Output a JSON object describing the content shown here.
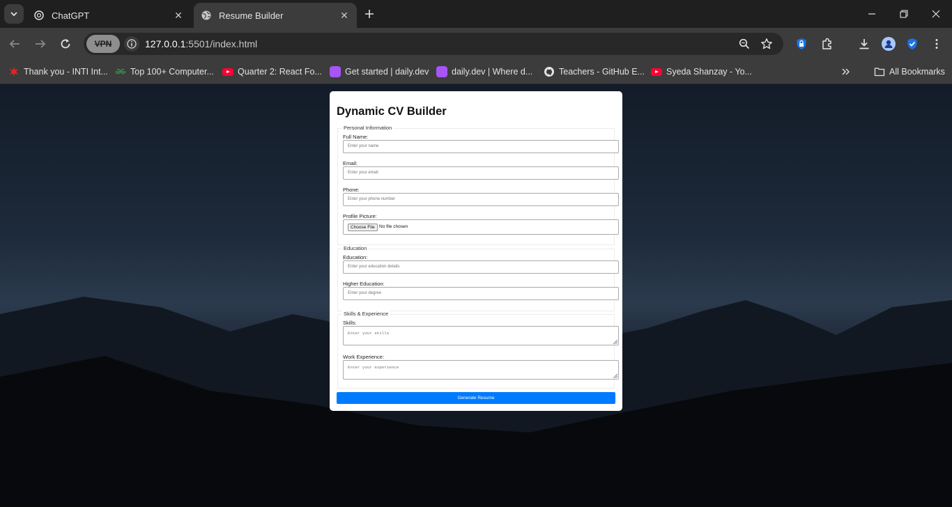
{
  "browser": {
    "tabs": [
      {
        "title": "ChatGPT",
        "active": false,
        "icon": "chatgpt-icon"
      },
      {
        "title": "Resume Builder",
        "active": true,
        "icon": "globe-icon"
      }
    ],
    "vpn_label": "VPN",
    "url_host": "127.0.0.1",
    "url_rest": ":5501/index.html",
    "bookmarks": [
      {
        "label": "Thank you - INTI Int...",
        "icon": "inti-icon"
      },
      {
        "label": "Top 100+ Computer...",
        "icon": "geeksforgeeks-icon"
      },
      {
        "label": "Quarter 2: React Fo...",
        "icon": "youtube-icon"
      },
      {
        "label": "Get started | daily.dev",
        "icon": "dailydev-icon"
      },
      {
        "label": "daily.dev | Where d...",
        "icon": "dailydev-icon"
      },
      {
        "label": "Teachers - GitHub E...",
        "icon": "github-icon"
      },
      {
        "label": "Syeda Shanzay - Yo...",
        "icon": "youtube-icon"
      }
    ],
    "all_bookmarks_label": "All Bookmarks",
    "colors": {
      "accent": "#007bff",
      "chrome_dark": "#1f1f1f",
      "chrome_toolbar": "#3c3c3c"
    }
  },
  "form": {
    "title": "Dynamic CV Builder",
    "personal": {
      "legend": "Personal Information",
      "full_name_label": "Full Name:",
      "full_name_placeholder": "Enter your name",
      "email_label": "Email:",
      "email_placeholder": "Enter your email",
      "phone_label": "Phone:",
      "phone_placeholder": "Enter your phone number",
      "picture_label": "Profile Picture:",
      "choose_file": "Choose File",
      "file_status": "No file chosen"
    },
    "education": {
      "legend": "Education",
      "education_label": "Education:",
      "education_placeholder": "Enter your education details",
      "higher_label": "Higher Education:",
      "higher_placeholder": "Enter your degree"
    },
    "skills": {
      "legend": "Skills & Experience",
      "skills_label": "Skills:",
      "skills_placeholder": "Enter your skills",
      "experience_label": "Work Experience:",
      "experience_placeholder": "Enter your experience"
    },
    "generate_button": "Generate Resume"
  }
}
